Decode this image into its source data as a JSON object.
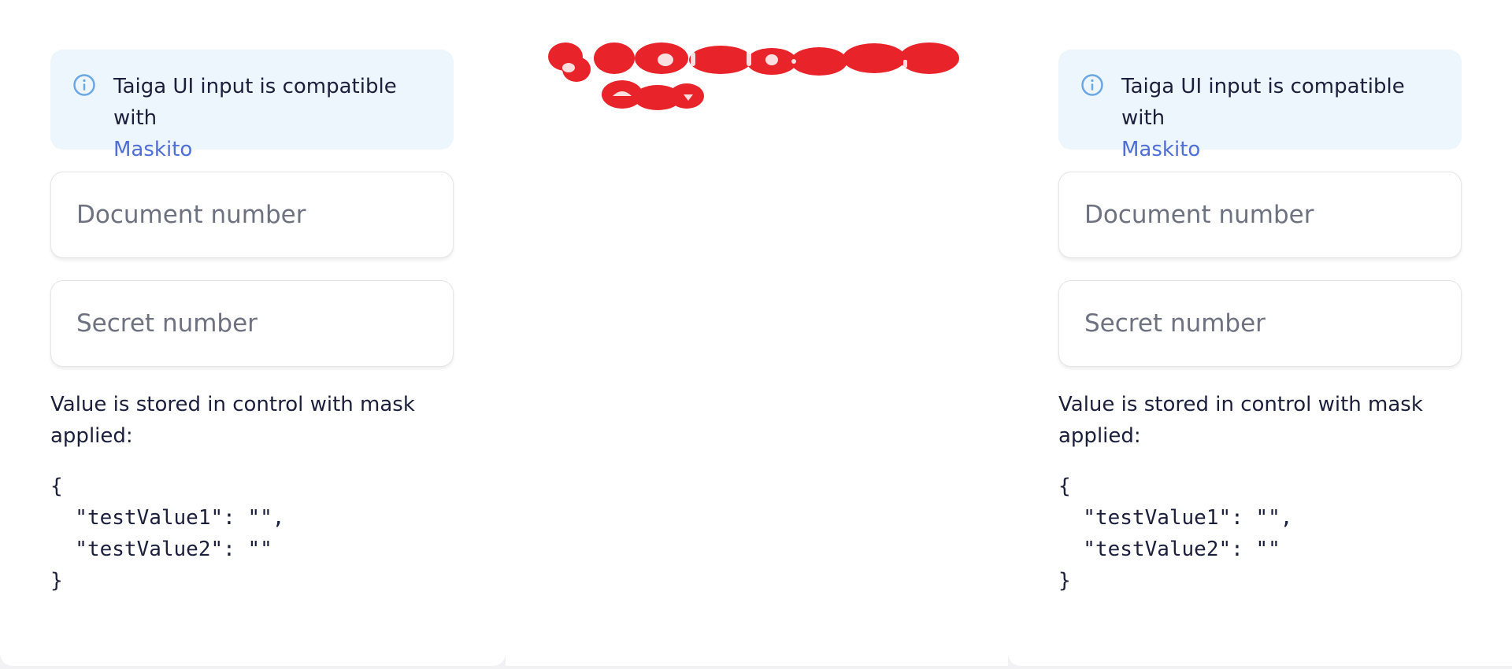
{
  "panels": [
    {
      "notice": {
        "text": "Taiga UI input is compatible with",
        "link": "Maskito"
      },
      "fields": {
        "document_placeholder": "Document number",
        "secret_placeholder": "Secret number"
      },
      "caption": "Value is stored in control with mask applied:",
      "code": "{\n  \"testValue1\": \"\",\n  \"testValue2\": \"\"\n}"
    },
    {
      "notice": {
        "text": "Taiga UI input is compatible with",
        "link": "Maskito"
      },
      "fields": {
        "document_placeholder": "Document number",
        "secret_placeholder": "Secret number"
      },
      "caption": "Value is stored in control with mask applied:",
      "code": "{\n  \"testValue1\": \"\",\n  \"testValue2\": \"\"\n}"
    }
  ],
  "colors": {
    "notice_bg": "#edf5fd",
    "info_icon": "#6aa8e3",
    "link": "#4f6fd6",
    "scribble": "#e8232a"
  },
  "icons": [
    "info-icon"
  ]
}
